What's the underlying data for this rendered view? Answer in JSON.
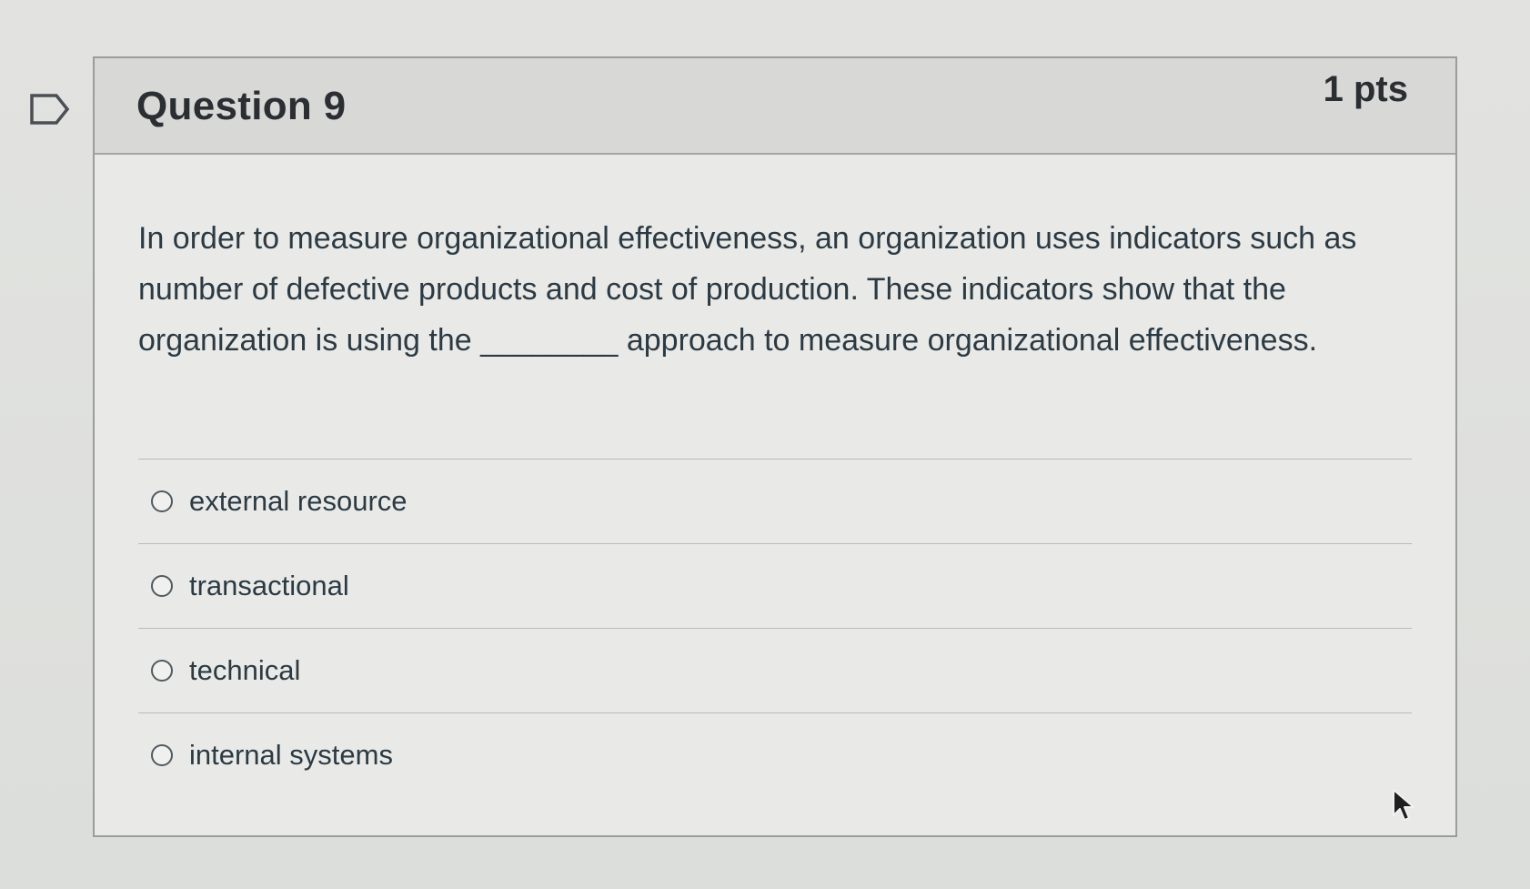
{
  "question": {
    "title": "Question 9",
    "points": "1 pts",
    "text": "In order to measure organizational effectiveness, an organization uses indicators such as number of defective products and cost of production. These indicators show that the organization is using the ________ approach to measure organizational effectiveness."
  },
  "answers": [
    {
      "label": "external resource",
      "selected": false
    },
    {
      "label": "transactional",
      "selected": false
    },
    {
      "label": "technical",
      "selected": false
    },
    {
      "label": "internal systems",
      "selected": false
    }
  ],
  "icons": {
    "flag": "flag-outline-icon",
    "cursor": "mouse-pointer-icon"
  },
  "colors": {
    "header_bg": "#d8d9d6",
    "text": "#2c3a44",
    "border": "#9a9d9b"
  }
}
